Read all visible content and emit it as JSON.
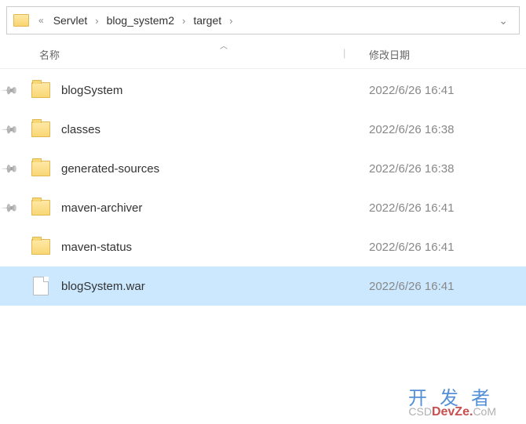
{
  "breadcrumb": {
    "items": [
      "Servlet",
      "blog_system2",
      "target"
    ]
  },
  "columns": {
    "name": "名称",
    "date": "修改日期"
  },
  "files": [
    {
      "name": "blogSystem",
      "date": "2022/6/26 16:41",
      "type": "folder",
      "pinned": true,
      "selected": false
    },
    {
      "name": "classes",
      "date": "2022/6/26 16:38",
      "type": "folder",
      "pinned": true,
      "selected": false
    },
    {
      "name": "generated-sources",
      "date": "2022/6/26 16:38",
      "type": "folder",
      "pinned": true,
      "selected": false
    },
    {
      "name": "maven-archiver",
      "date": "2022/6/26 16:41",
      "type": "folder",
      "pinned": true,
      "selected": false
    },
    {
      "name": "maven-status",
      "date": "2022/6/26 16:41",
      "type": "folder",
      "pinned": false,
      "selected": false
    },
    {
      "name": "blogSystem.war",
      "date": "2022/6/26 16:41",
      "type": "file",
      "pinned": false,
      "selected": true
    }
  ],
  "watermark": {
    "line1": "开发者",
    "line2_prefix": "CSD",
    "line2_mid": "DevZe",
    "line2_suffix": "CoM"
  }
}
